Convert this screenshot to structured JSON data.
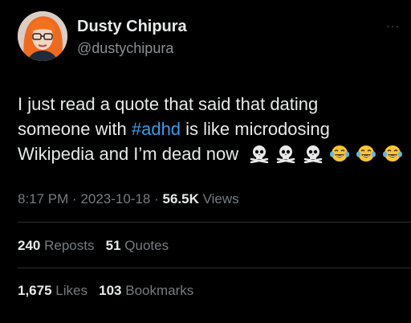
{
  "author": {
    "display_name": "Dusty Chipura",
    "handle": "@dustychipura"
  },
  "more_label": "···",
  "tweet": {
    "line1": "I just read a quote that said that dating",
    "line2_before": "someone with ",
    "hashtag": "#adhd",
    "line2_after": " is like microdosing",
    "line3": "Wikipedia and I’m dead now",
    "emojis": [
      "skull-and-crossbones",
      "skull-and-crossbones",
      "skull-and-crossbones",
      "face-with-tears-of-joy",
      "face-with-tears-of-joy",
      "face-with-tears-of-joy"
    ]
  },
  "meta": {
    "time": "8:17 PM",
    "sep1": " · ",
    "date": "2023-10-18",
    "sep2": " · ",
    "views_count": "56.5K",
    "views_label": " Views"
  },
  "engagement": {
    "reposts_count": "240",
    "reposts_label": " Reposts",
    "quotes_count": "51",
    "quotes_label": " Quotes",
    "likes_count": "1,675",
    "likes_label": " Likes",
    "bookmarks_count": "103",
    "bookmarks_label": " Bookmarks"
  },
  "colors": {
    "background": "#000000",
    "text": "#e7e9ea",
    "muted": "#777c81",
    "link": "#3b9ce8",
    "divider": "#2a2d30"
  }
}
